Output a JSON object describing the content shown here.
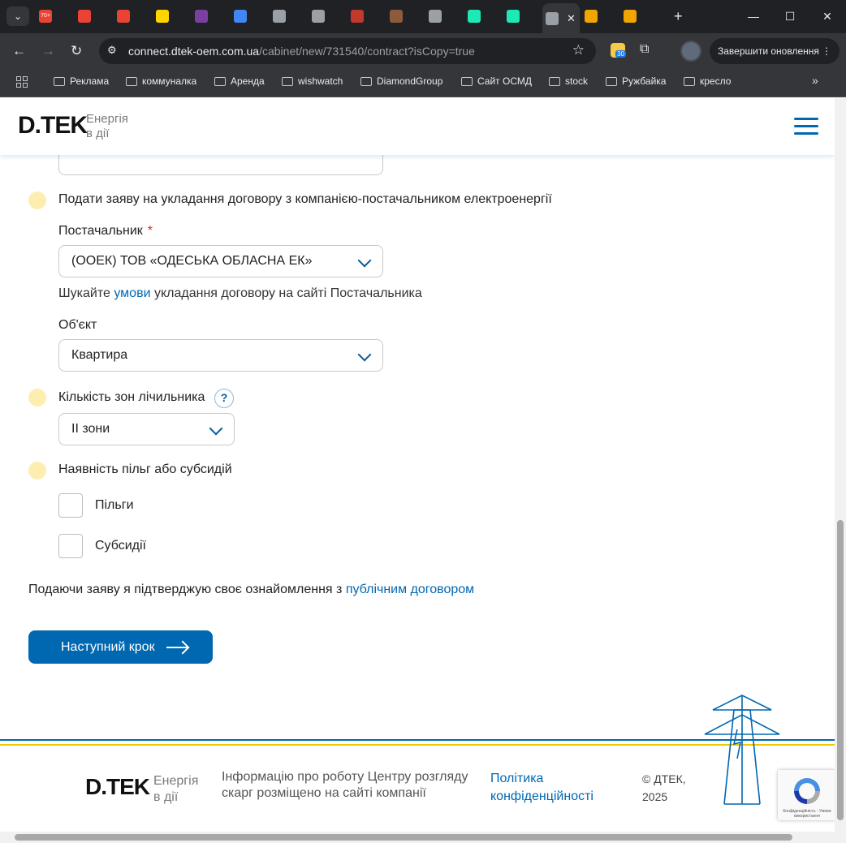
{
  "browser": {
    "tabs": [
      {
        "badge": "70+",
        "color": "#ea4335"
      },
      {
        "badge": "",
        "color": "#ea4335"
      },
      {
        "badge": "",
        "color": "#ea4335"
      },
      {
        "badge": "",
        "color": "#ffd500"
      },
      {
        "badge": "",
        "color": "#7b3fa0"
      },
      {
        "badge": "",
        "color": "#4285f4"
      },
      {
        "badge": "",
        "color": "#9aa0a6"
      },
      {
        "badge": "",
        "color": "#9aa0a6"
      },
      {
        "badge": "",
        "color": "#c0392b"
      },
      {
        "badge": "",
        "color": "#8d5a3b"
      },
      {
        "badge": "",
        "color": "#9aa0a6"
      },
      {
        "badge": "",
        "color": "#1de9b6"
      },
      {
        "badge": "",
        "color": "#1de9b6"
      },
      {
        "badge": "",
        "color": "#9aa0a6"
      },
      {
        "badge": "",
        "color": "#f0a500"
      },
      {
        "badge": "",
        "color": "#f0a500"
      }
    ],
    "url_host": "connect.dtek-oem.com.ua",
    "url_path": "/cabinet/new/731540/contract?isCopy=true",
    "extension_badge": "30",
    "update_button": "Завершити оновлення",
    "bookmarks": [
      "Реклама",
      "коммуналка",
      "Аренда",
      "wishwatch",
      "DiamondGroup",
      "Сайт ОСМД",
      "stock",
      "Ружбайка",
      "кресло"
    ]
  },
  "header": {
    "logo": "D.TEK",
    "tagline_line1": "Енергія",
    "tagline_line2": "в дії"
  },
  "form": {
    "contract_step_label": "Подати заяву на укладання договору з компанією-постачальником електроенергії",
    "supplier_label": "Постачальник",
    "supplier_required": "*",
    "supplier_value": "(ООЕК) ТОВ «ОДЕСЬКА ОБЛАСНА ЕК»",
    "terms_prefix": "Шукайте",
    "terms_link": "умови",
    "terms_suffix": "укладання договору на сайті Постачальника",
    "object_label": "Об'єкт",
    "object_value": "Квартира",
    "zones_label": "Кількість зон лічильника",
    "zones_help": "?",
    "zones_value": "ІІ зони",
    "benefits_label": "Наявність пільг або субсидій",
    "benefit_option": "Пільги",
    "subsidy_option": "Субсидії",
    "agree_prefix": "Подаючи заяву я підтверджую своє ознайомлення з",
    "agree_link": "публічним договором",
    "next_button": "Наступний крок"
  },
  "footer": {
    "logo": "D.TEK",
    "tagline_line1": "Енергія",
    "tagline_line2": "в дії",
    "info_line1": "Інформацію про роботу Центру розгляду",
    "info_line2": "скарг розміщено на сайті компанії",
    "privacy_line1": "Політика",
    "privacy_line2": "конфіденційності",
    "copyright_line1": "© ДТЕК,",
    "copyright_line2": "2025",
    "recaptcha_text": "Конфіденційність - Умови використання"
  },
  "colors": {
    "brand_blue": "#0068b1",
    "brand_yellow": "#f2c500",
    "step_dot": "#fdeeb0",
    "required": "#d62b2b"
  }
}
